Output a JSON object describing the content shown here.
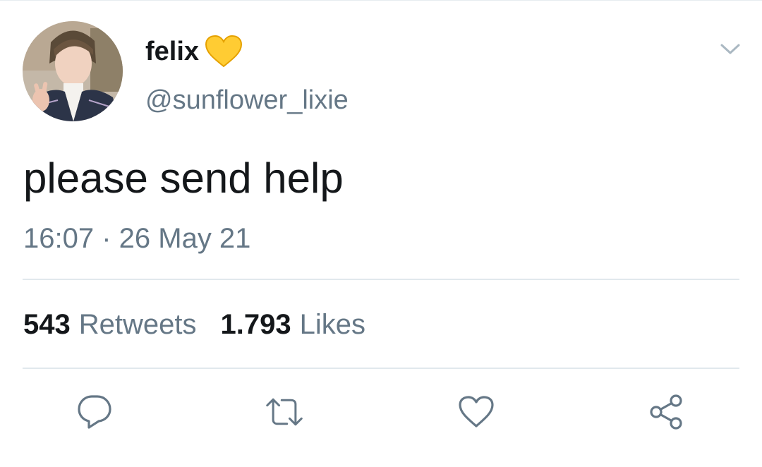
{
  "tweet": {
    "author": {
      "display_name": "felix",
      "name_emoji": "yellow-heart-emoji",
      "handle": "@sunflower_lixie"
    },
    "text": "please send help",
    "timestamp": "16:07 · 26 May 21",
    "stats": {
      "retweets_count": "543",
      "retweets_label": "Retweets",
      "likes_count": "1.793",
      "likes_label": "Likes"
    },
    "menu_icon": "chevron-down-icon",
    "actions": [
      {
        "icon": "reply-icon"
      },
      {
        "icon": "retweet-icon"
      },
      {
        "icon": "like-icon"
      },
      {
        "icon": "share-icon"
      }
    ]
  },
  "colors": {
    "text_primary": "#14171a",
    "text_secondary": "#657786",
    "divider": "#e1e8ed",
    "heart_emoji": "#ffcc33",
    "icon": "#657786"
  }
}
